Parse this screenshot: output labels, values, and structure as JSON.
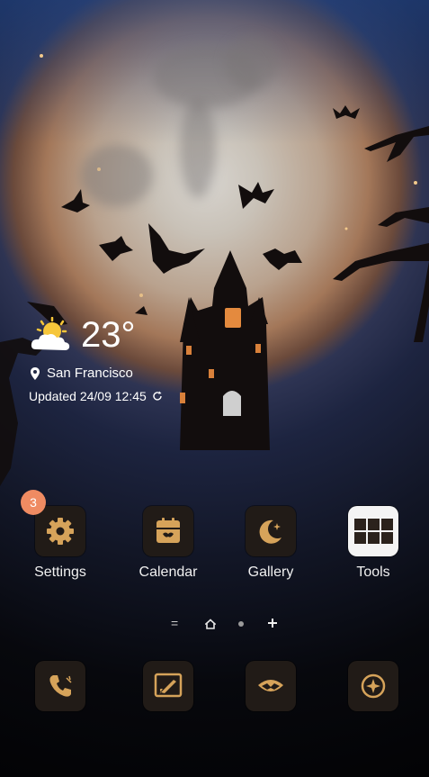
{
  "weather": {
    "temperature": "23°",
    "city": "San Francisco",
    "updated": "Updated 24/09 12:45",
    "icon": "partly-cloudy-sun-icon"
  },
  "apps": [
    {
      "label": "Settings",
      "icon": "gear-icon",
      "badge": "3"
    },
    {
      "label": "Calendar",
      "icon": "calendar-icon"
    },
    {
      "label": "Gallery",
      "icon": "moon-gallery-icon"
    },
    {
      "label": "Tools",
      "icon": "tools-folder-icon"
    }
  ],
  "dock": [
    {
      "icon": "phone-icon"
    },
    {
      "icon": "messages-icon"
    },
    {
      "icon": "browser-bat-icon"
    },
    {
      "icon": "compass-icon"
    }
  ],
  "page_indicator": {
    "pages": 4,
    "current": 2
  },
  "colors": {
    "accent": "#d6a35a",
    "badge": "#ef8b62",
    "tile": "#211b17"
  }
}
